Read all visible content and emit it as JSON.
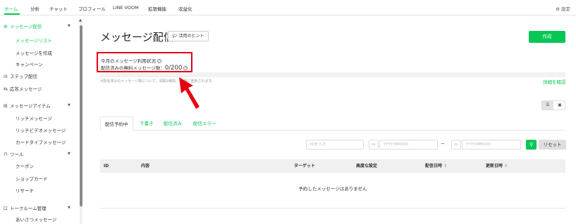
{
  "topnav": {
    "tabs": [
      "ホーム",
      "分析",
      "チャット",
      "プロフィール",
      "LINE VOOM",
      "拡張機能",
      "収益化"
    ],
    "settings_label": "設定"
  },
  "sidebar": {
    "items": [
      {
        "label": "メッセージ配信",
        "icon": "message-send-icon"
      },
      {
        "label": "メッセージリスト"
      },
      {
        "label": "メッセージを作成"
      },
      {
        "label": "キャンペーン"
      },
      {
        "label": "ステップ配信",
        "icon": "step-icon"
      },
      {
        "label": "応答メッセージ",
        "icon": "reply-icon"
      },
      {
        "label": "メッセージアイテム",
        "icon": "item-icon"
      },
      {
        "label": "リッチメッセージ"
      },
      {
        "label": "リッチビデオメッセージ"
      },
      {
        "label": "カードタイプメッセージ"
      },
      {
        "label": "ツール",
        "icon": "tool-icon"
      },
      {
        "label": "クーポン"
      },
      {
        "label": "ショップカード"
      },
      {
        "label": "リサーチ"
      },
      {
        "label": "トークルーム管理",
        "icon": "talkroom-icon"
      },
      {
        "label": "あいさつメッセージ"
      }
    ]
  },
  "main": {
    "title": "メッセージ配信",
    "hint_button": "活用のヒント",
    "create_button": "作成",
    "usage": {
      "line1": "今月のメッセージ利用状況",
      "line2_label": "配信済みの無料メッセージ数：",
      "line2_count": "0/200"
    },
    "note": "※配信済みのメッセージ数について、週間1時間… 随時に更新されます。",
    "detail_link": "詳細を確認",
    "status_tabs": [
      "配信予約中",
      "下書き",
      "配信済み",
      "配信エラー"
    ],
    "filters": {
      "id_placeholder": "IDを入力",
      "date_from_placeholder": "YYYY/MM/DD",
      "date_to_placeholder": "YYYY/MM/DD",
      "reset_label": "リセット"
    },
    "table": {
      "headers": [
        "ID",
        "内容",
        "ターゲット",
        "高度な設定",
        "配信日時",
        "更新日時"
      ],
      "empty_message": "予約したメッセージはありません"
    }
  },
  "colors": {
    "accent": "#06c755",
    "highlight": "#e60012"
  }
}
